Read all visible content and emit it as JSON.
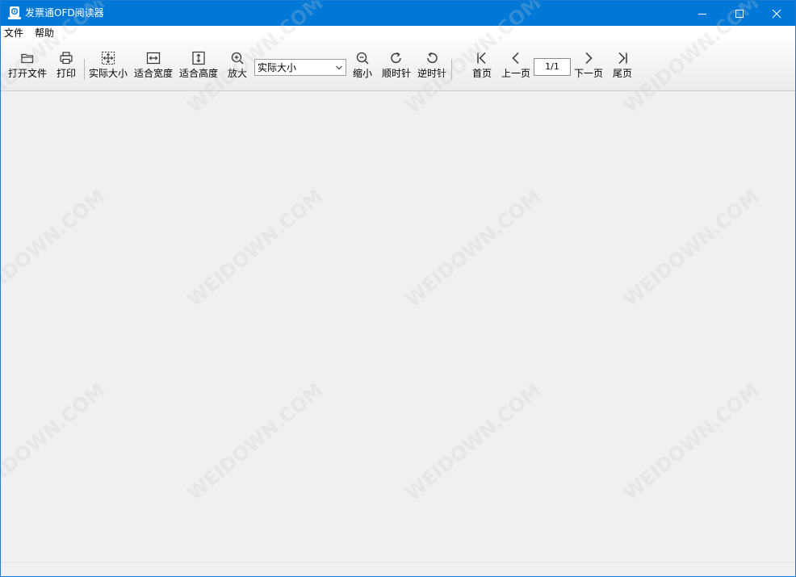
{
  "window": {
    "title": "发票通OFD阅读器"
  },
  "menu": {
    "items": [
      "文件",
      "帮助"
    ]
  },
  "toolbar": {
    "open_label": "打开文件",
    "print_label": "打印",
    "actual_size_label": "实际大小",
    "fit_width_label": "适合宽度",
    "fit_height_label": "适合高度",
    "zoom_in_label": "放大",
    "zoom_select_value": "实际大小",
    "zoom_out_label": "缩小",
    "rotate_cw_label": "顺时针",
    "rotate_ccw_label": "逆时针",
    "first_page_label": "首页",
    "prev_page_label": "上一页",
    "page_value": "1/1",
    "next_page_label": "下一页",
    "last_page_label": "尾页"
  },
  "watermark": {
    "text": "WEIDOWN.COM"
  },
  "colors": {
    "titlebar": "#0078d7",
    "workspace": "#f0f0f0"
  },
  "icons": {
    "app": "app-logo-icon",
    "open": "folder-icon",
    "print": "printer-icon",
    "actual_size": "actual-size-icon",
    "fit_width": "fit-width-icon",
    "fit_height": "fit-height-icon",
    "zoom_in": "zoom-in-icon",
    "zoom_out": "zoom-out-icon",
    "rotate_cw": "rotate-clockwise-icon",
    "rotate_ccw": "rotate-counterclockwise-icon",
    "first": "first-page-icon",
    "prev": "chevron-left-icon",
    "next": "chevron-right-icon",
    "last": "last-page-icon"
  }
}
